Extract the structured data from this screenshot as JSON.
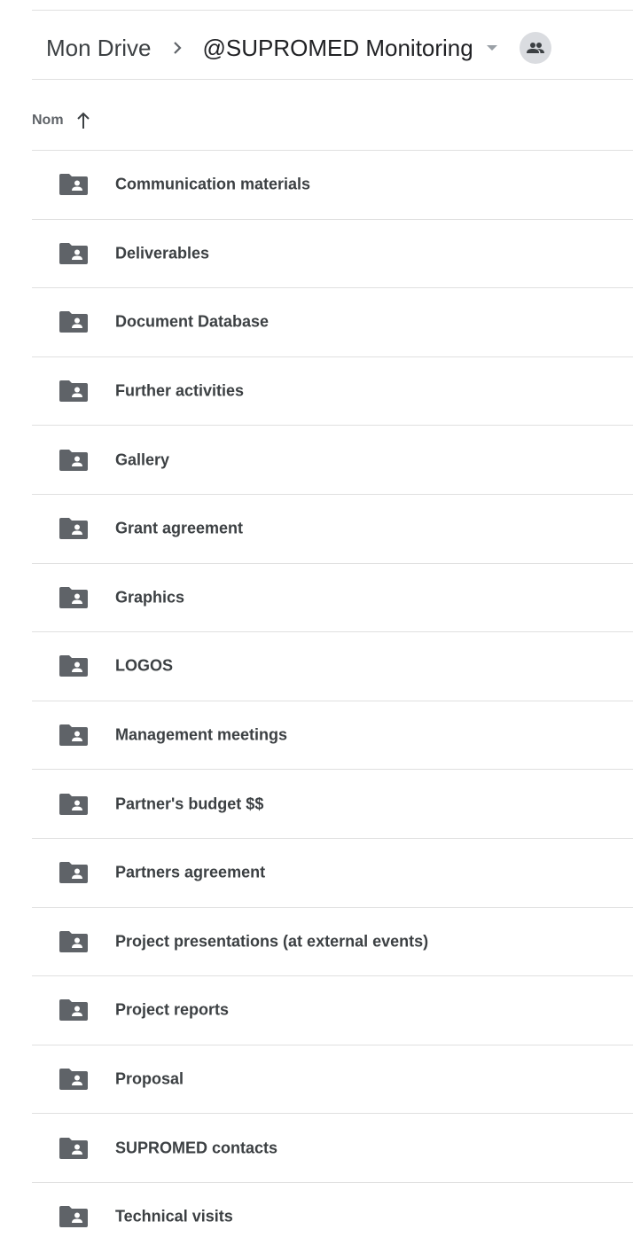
{
  "breadcrumb": {
    "root_label": "Mon Drive",
    "current_label": "@SUPROMED Monitoring"
  },
  "icons": {
    "separator": "chevron-right-icon",
    "dropdown": "dropdown-arrow-icon",
    "shared": "shared-people-icon",
    "sort": "arrow-up-icon",
    "folder": "shared-folder-icon"
  },
  "colors": {
    "folder_icon": "#5f6368",
    "divider": "#e0e0e0",
    "shared_badge_bg": "#dadce0"
  },
  "list_header": {
    "name_label": "Nom",
    "sort_direction": "ascending"
  },
  "folders": [
    {
      "name": "Communication materials"
    },
    {
      "name": "Deliverables"
    },
    {
      "name": "Document Database"
    },
    {
      "name": "Further activities"
    },
    {
      "name": "Gallery"
    },
    {
      "name": "Grant agreement"
    },
    {
      "name": "Graphics"
    },
    {
      "name": "LOGOS"
    },
    {
      "name": "Management meetings"
    },
    {
      "name": "Partner's budget $$"
    },
    {
      "name": "Partners agreement"
    },
    {
      "name": "Project presentations (at external events)"
    },
    {
      "name": "Project reports"
    },
    {
      "name": "Proposal"
    },
    {
      "name": "SUPROMED contacts"
    },
    {
      "name": "Technical visits"
    }
  ]
}
